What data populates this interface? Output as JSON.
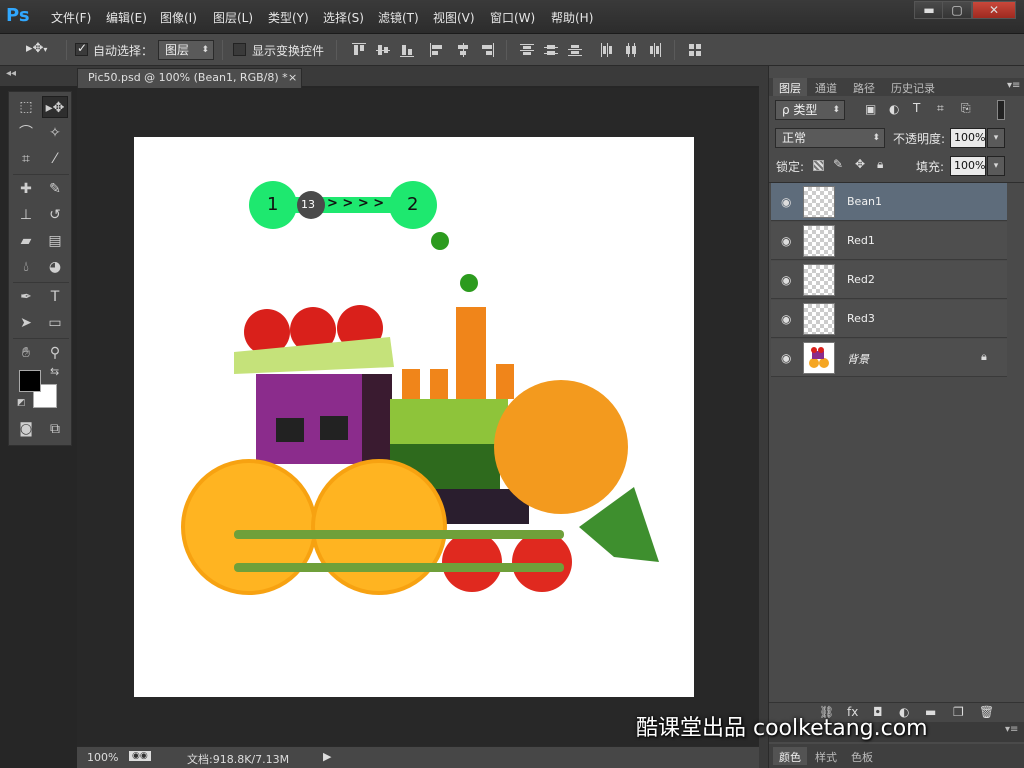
{
  "app": {
    "logo": "Ps"
  },
  "menu": [
    "文件(F)",
    "编辑(E)",
    "图像(I)",
    "图层(L)",
    "类型(Y)",
    "选择(S)",
    "滤镜(T)",
    "视图(V)",
    "窗口(W)",
    "帮助(H)"
  ],
  "window_controls": {
    "minimize": "▬",
    "maximize": "▢",
    "close": "✕"
  },
  "options_bar": {
    "auto_select_label": "自动选择：",
    "auto_select_checked": true,
    "auto_select_target": "图层",
    "show_transform_label": "显示变换控件",
    "show_transform_checked": false
  },
  "document": {
    "tab_title": "Pic50.psd @ 100% (Bean1, RGB/8) *",
    "tab_close": "×",
    "zoom": "100%",
    "doc_info": "文档:918.8K/7.13M"
  },
  "tools": {
    "active": "move-tool",
    "foreground_color": "#000000",
    "background_color": "#ffffff"
  },
  "canvas_overlay": {
    "node1_label": "1",
    "node2_label": "2",
    "counter": "13",
    "arrows": "> > > >",
    "node_color": "#1ee86f"
  },
  "layers_panel": {
    "tabs": [
      "图层",
      "通道",
      "路径",
      "历史记录"
    ],
    "filter_label": "ρ 类型",
    "blend_mode": "正常",
    "opacity_label": "不透明度:",
    "opacity_value": "100%",
    "lock_label": "锁定:",
    "fill_label": "填充:",
    "fill_value": "100%",
    "layers": [
      {
        "name": "Bean1",
        "selected": true,
        "visible": true
      },
      {
        "name": "Red1",
        "selected": false,
        "visible": true
      },
      {
        "name": "Red2",
        "selected": false,
        "visible": true
      },
      {
        "name": "Red3",
        "selected": false,
        "visible": true
      },
      {
        "name": "背景",
        "selected": false,
        "visible": true,
        "locked": true
      }
    ]
  },
  "bottom_panel_tabs": [
    "颜色",
    "样式",
    "色板"
  ],
  "watermark": "酷课堂出品 coolketang.com"
}
